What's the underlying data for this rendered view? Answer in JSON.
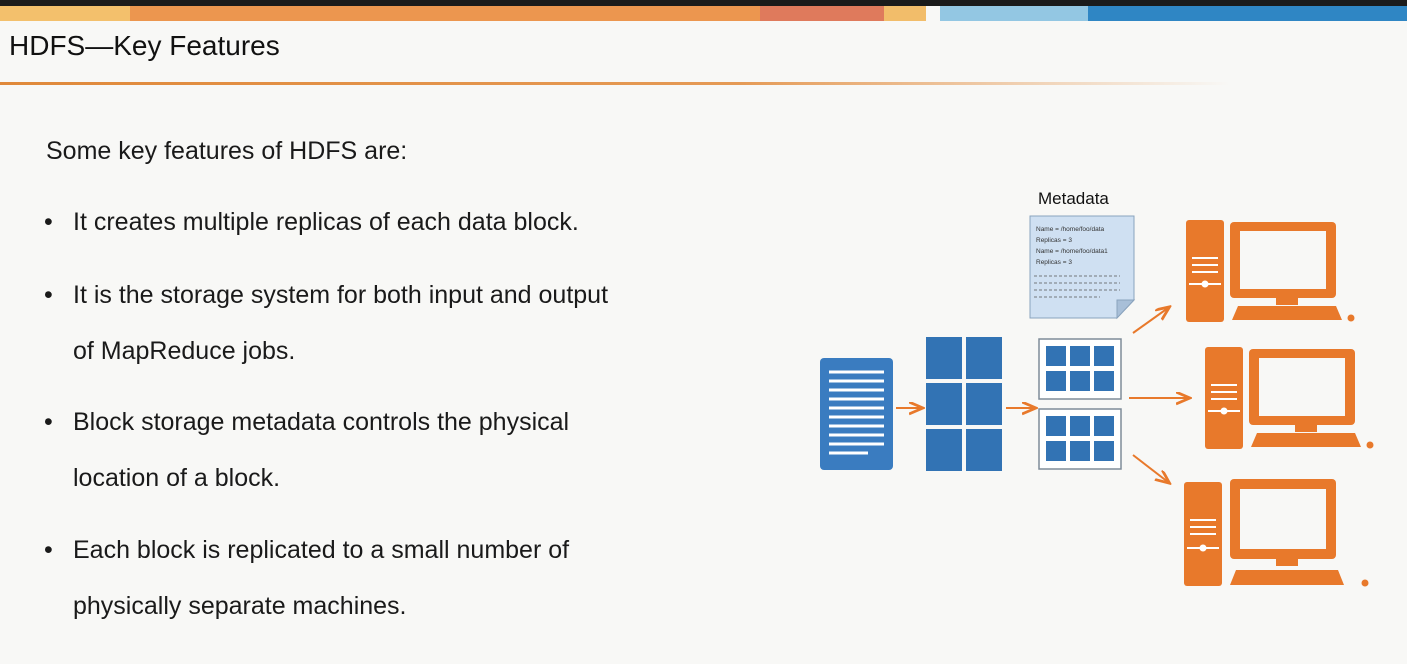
{
  "header": {
    "title": "HDFS—Key Features"
  },
  "content": {
    "intro": "Some key features of HDFS are:",
    "bullets": [
      {
        "lines": [
          "It creates multiple replicas of each data block."
        ]
      },
      {
        "lines": [
          "It is the storage system for both input and output",
          "of MapReduce jobs."
        ]
      },
      {
        "lines": [
          "Block storage metadata controls the physical",
          "location of a block."
        ]
      },
      {
        "lines": [
          "Each block is replicated to a small number of",
          "physically separate machines."
        ]
      }
    ]
  },
  "diagram": {
    "metadata_label": "Metadata",
    "metadata_lines": [
      "Name = /home/foo/data",
      "Replicas = 3",
      "Name = /home/foo/data1",
      "Replicas = 3"
    ]
  },
  "colors": {
    "accent_orange": "#e8792b",
    "block_blue": "#3273b4",
    "doc_blue": "#3a7cc0",
    "note_blue": "#cfe0f2"
  }
}
